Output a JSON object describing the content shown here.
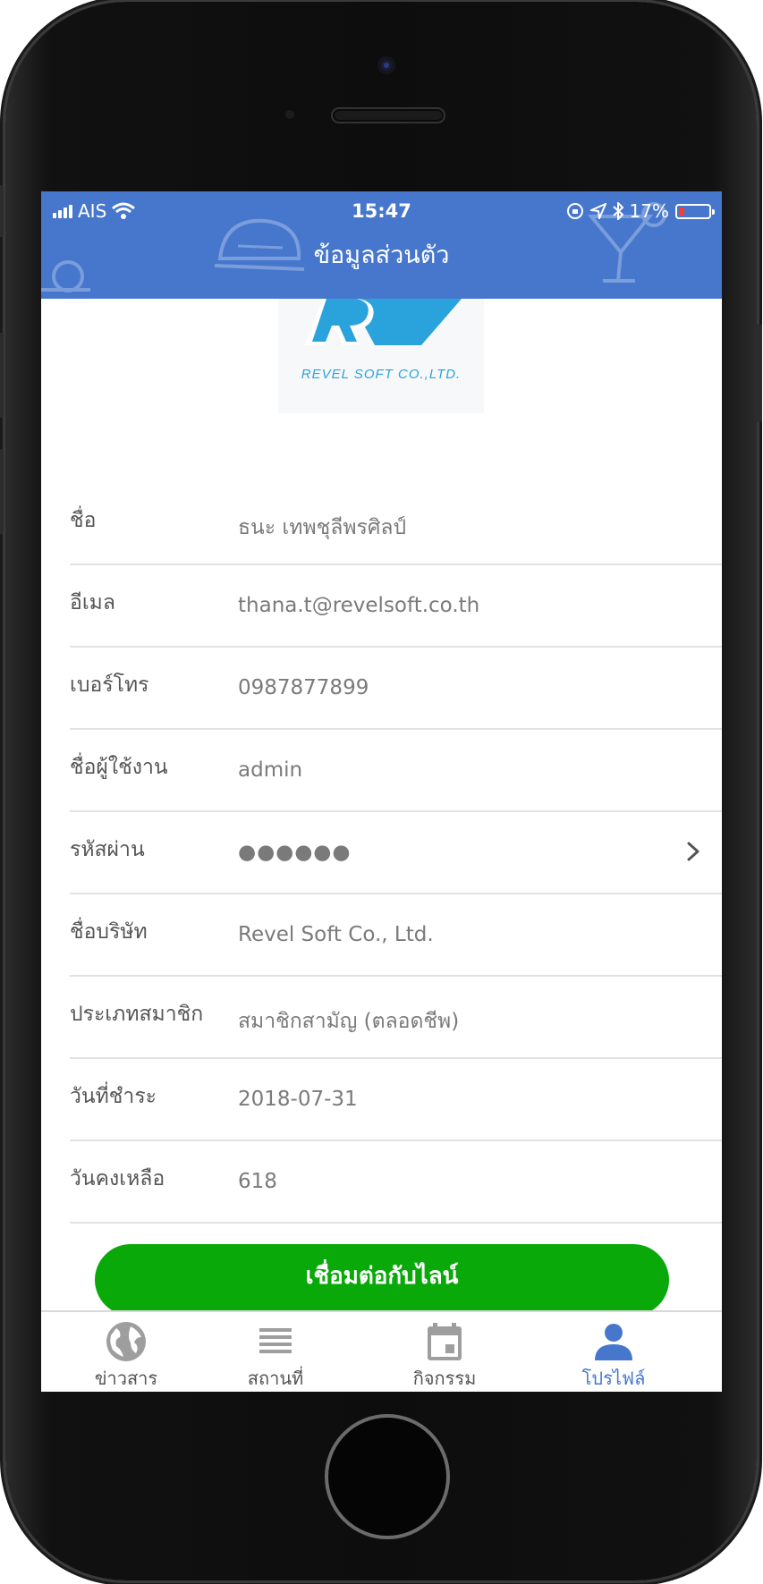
{
  "status_bar": {
    "carrier": "AIS",
    "time": "15:47",
    "battery_percent": "17%",
    "battery_level": 0.17
  },
  "header": {
    "title": "ข้อมูลส่วนตัว",
    "color": "#4677cd"
  },
  "logo": {
    "text": "REVEL SOFT CO.,LTD."
  },
  "profile": {
    "rows": [
      {
        "label": "ชื่อ",
        "value": "ธนะ เทพชุลีพรศิลป์"
      },
      {
        "label": "อีเมล",
        "value": "thana.t@revelsoft.co.th"
      },
      {
        "label": "เบอร์โทร",
        "value": "0987877899"
      },
      {
        "label": "ชื่อผู้ใช้งาน",
        "value": "admin"
      },
      {
        "label": "รหัสผ่าน",
        "value": "●●●●●●"
      },
      {
        "label": "ชื่อบริษัท",
        "value": "Revel Soft Co., Ltd."
      },
      {
        "label": "ประเภทสมาชิก",
        "value": "สมาชิกสามัญ (ตลอดชีพ)"
      },
      {
        "label": "วันที่ชำระ",
        "value": "2018-07-31"
      },
      {
        "label": "วันคงเหลือ",
        "value": "618"
      }
    ]
  },
  "line_button": {
    "label": "เชื่อมต่อกับไลน์",
    "color": "#0aa90a"
  },
  "tabbar": {
    "tabs": [
      {
        "label": "ข่าวสาร",
        "icon": "globe-icon"
      },
      {
        "label": "สถานที่",
        "icon": "list-icon"
      },
      {
        "label": "กิจกรรม",
        "icon": "calendar-icon"
      },
      {
        "label": "โปรไฟล์",
        "icon": "person-icon",
        "active": true
      }
    ],
    "active_color": "#4677cd",
    "inactive_color": "#9e9e9e"
  }
}
